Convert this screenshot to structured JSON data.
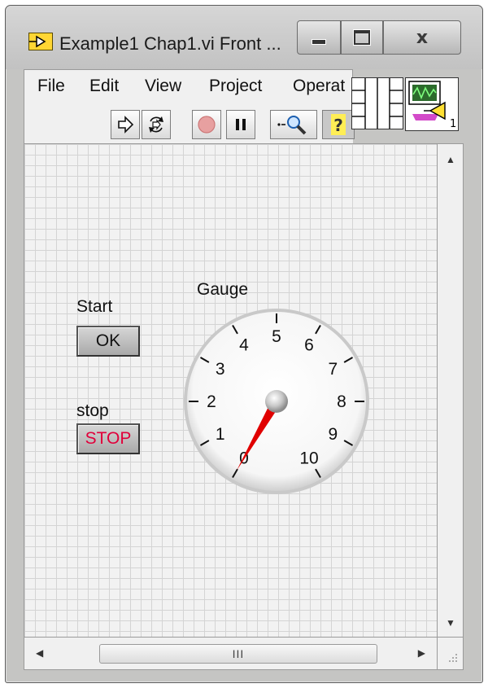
{
  "window": {
    "title": "Example1 Chap1.vi Front ...",
    "app_icon": "labview-vi-icon",
    "controls": {
      "minimize": "minimize-icon",
      "maximize": "maximize-icon",
      "close": "x"
    }
  },
  "menu": [
    "File",
    "Edit",
    "View",
    "Project",
    "Operat"
  ],
  "toolbar": {
    "buttons": [
      "run-arrow-icon",
      "run-continuously-icon",
      "abort-icon",
      "pause-icon",
      "highlight-execution-icon",
      "context-help-icon"
    ]
  },
  "connector": {
    "vi_icon_number": "1"
  },
  "panel": {
    "start": {
      "label": "Start",
      "button_text": "OK"
    },
    "stop": {
      "label": "stop",
      "button_text": "STOP",
      "text_color": "#e0003b"
    },
    "gauge": {
      "label": "Gauge",
      "scale": [
        "0",
        "1",
        "2",
        "3",
        "4",
        "5",
        "6",
        "7",
        "8",
        "9",
        "10"
      ],
      "min": 0,
      "max": 10,
      "value": 0,
      "needle_color": "#e00000"
    }
  },
  "scroll": {
    "thumb_grip": "III"
  }
}
